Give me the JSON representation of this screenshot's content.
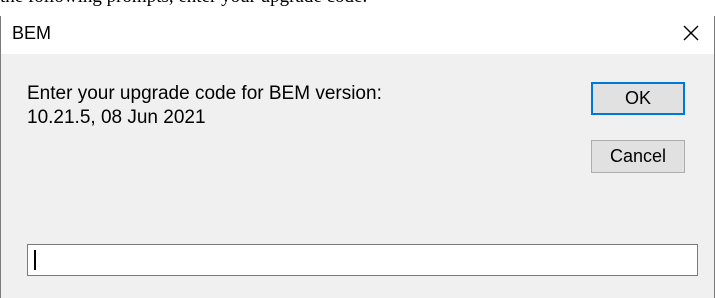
{
  "background_text": "the following prompts, enter your upgrade code.",
  "dialog": {
    "title": "BEM",
    "close_icon": "close-icon",
    "prompt_line1": "Enter your upgrade code for BEM version:",
    "prompt_line2": "10.21.5, 08 Jun 2021",
    "ok_label": "OK",
    "cancel_label": "Cancel",
    "input_value": ""
  },
  "colors": {
    "focus_border": "#0078d7",
    "dialog_bg": "#f0f0f0",
    "button_bg": "#e1e1e1"
  }
}
